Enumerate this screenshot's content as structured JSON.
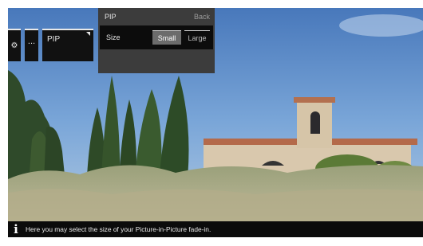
{
  "toolbar": {
    "gear_icon": "gear-icon",
    "more_label": "...",
    "pip_label": "PIP"
  },
  "pip_menu": {
    "title": "PIP",
    "back_label": "Back",
    "size_label": "Size",
    "options": [
      "Small",
      "Large"
    ],
    "selected": "Small"
  },
  "info": {
    "icon": "info-icon",
    "text": "Here you may select the size of your Picture-in-Picture fade-in."
  }
}
